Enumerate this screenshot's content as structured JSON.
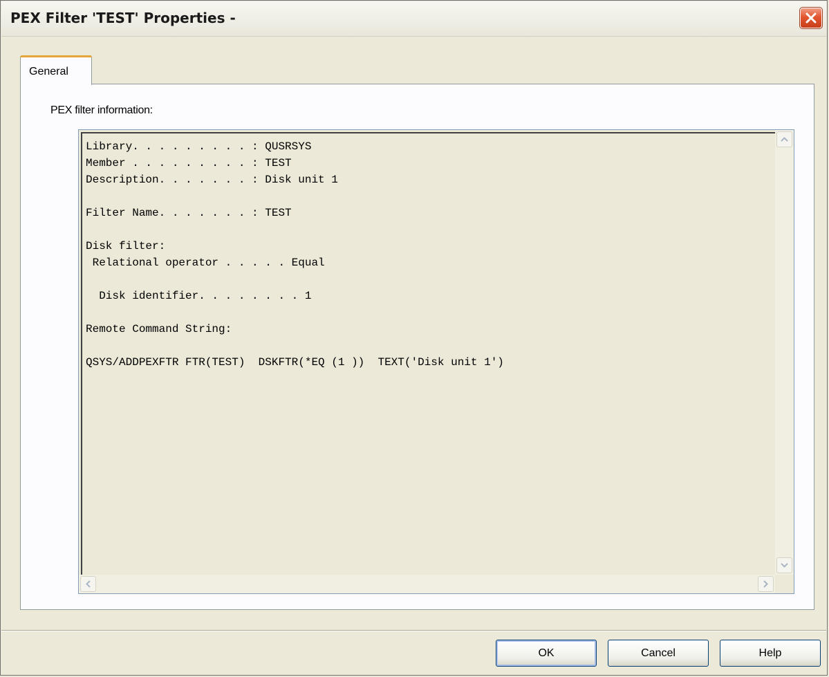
{
  "window": {
    "title": "PEX Filter 'TEST' Properties -"
  },
  "tabs": [
    {
      "label": "General",
      "selected": true
    }
  ],
  "general": {
    "section_label": "PEX filter information:",
    "lines": [
      "Library. . . . . . . . . : QUSRSYS",
      "Member . . . . . . . . . : TEST",
      "Description. . . . . . . : Disk unit 1",
      "",
      "Filter Name. . . . . . . : TEST",
      "",
      "Disk filter:",
      " Relational operator . . . . . Equal",
      "",
      "  Disk identifier. . . . . . . . 1",
      "",
      "Remote Command String:",
      "",
      "QSYS/ADDPEXFTR FTR(TEST)  DSKFTR(*EQ (1 ))  TEXT('Disk unit 1')"
    ]
  },
  "buttons": {
    "ok": "OK",
    "cancel": "Cancel",
    "help": "Help"
  },
  "icons": {
    "close": "close-icon",
    "scroll_up": "arrow-up-icon",
    "scroll_down": "arrow-down-icon",
    "scroll_left": "arrow-left-icon",
    "scroll_right": "arrow-right-icon"
  },
  "colors": {
    "close_button": "#e2552f",
    "tab_highlight": "#e5a436",
    "button_border": "#003c74"
  }
}
